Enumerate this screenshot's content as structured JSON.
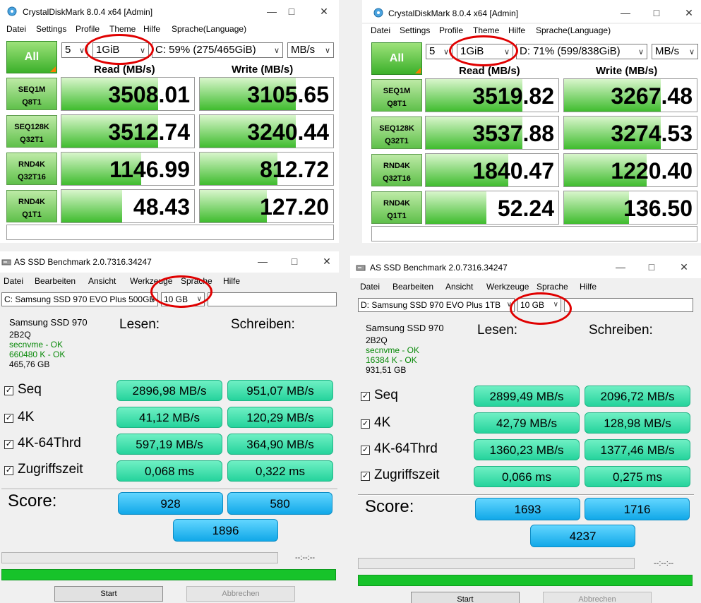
{
  "cdm_left": {
    "title": "CrystalDiskMark 8.0.4 x64 [Admin]",
    "menu": [
      "Datei",
      "Settings",
      "Profile",
      "Theme",
      "Hilfe",
      "Sprache(Language)"
    ],
    "all_label": "All",
    "count": "5",
    "size": "1GiB",
    "drive": "C: 59% (275/465GiB)",
    "unit": "MB/s",
    "read_header": "Read (MB/s)",
    "write_header": "Write (MB/s)",
    "rows": [
      {
        "l1": "SEQ1M",
        "l2": "Q8T1",
        "read": "3508.01",
        "write": "3105.65"
      },
      {
        "l1": "SEQ128K",
        "l2": "Q32T1",
        "read": "3512.74",
        "write": "3240.44"
      },
      {
        "l1": "RND4K",
        "l2": "Q32T16",
        "read": "1146.99",
        "write": "812.72"
      },
      {
        "l1": "RND4K",
        "l2": "Q1T1",
        "read": "48.43",
        "write": "127.20"
      }
    ]
  },
  "cdm_right": {
    "title": "CrystalDiskMark 8.0.4 x64 [Admin]",
    "menu": [
      "Datei",
      "Settings",
      "Profile",
      "Theme",
      "Hilfe",
      "Sprache(Language)"
    ],
    "all_label": "All",
    "count": "5",
    "size": "1GiB",
    "drive": "D: 71% (599/838GiB)",
    "unit": "MB/s",
    "read_header": "Read (MB/s)",
    "write_header": "Write (MB/s)",
    "rows": [
      {
        "l1": "SEQ1M",
        "l2": "Q8T1",
        "read": "3519.82",
        "write": "3267.48"
      },
      {
        "l1": "SEQ128K",
        "l2": "Q32T1",
        "read": "3537.88",
        "write": "3274.53"
      },
      {
        "l1": "RND4K",
        "l2": "Q32T16",
        "read": "1840.47",
        "write": "1220.40"
      },
      {
        "l1": "RND4K",
        "l2": "Q1T1",
        "read": "52.24",
        "write": "136.50"
      }
    ]
  },
  "asd_left": {
    "title": "AS SSD Benchmark 2.0.7316.34247",
    "menu": [
      "Datei",
      "Bearbeiten",
      "Ansicht",
      "Werkzeuge",
      "Sprache",
      "Hilfe"
    ],
    "drive_select": "C: Samsung SSD 970 EVO Plus 500GB",
    "size_select": "10 GB",
    "info": [
      "Samsung SSD 970",
      "2B2Q",
      "secnvme - OK",
      "660480 K - OK",
      "465,76 GB"
    ],
    "read_header": "Lesen:",
    "write_header": "Schreiben:",
    "rows": [
      {
        "label": "Seq",
        "read": "2896,98 MB/s",
        "write": "951,07 MB/s"
      },
      {
        "label": "4K",
        "read": "41,12 MB/s",
        "write": "120,29 MB/s"
      },
      {
        "label": "4K-64Thrd",
        "read": "597,19 MB/s",
        "write": "364,90 MB/s"
      },
      {
        "label": "Zugriffszeit",
        "read": "0,068 ms",
        "write": "0,322 ms"
      }
    ],
    "score_label": "Score:",
    "score_read": "928",
    "score_write": "580",
    "score_total": "1896",
    "timer": "--:--:--",
    "start_label": "Start",
    "abort_label": "Abbrechen",
    "progress": 1.0
  },
  "asd_right": {
    "title": "AS SSD Benchmark 2.0.7316.34247",
    "menu": [
      "Datei",
      "Bearbeiten",
      "Ansicht",
      "Werkzeuge",
      "Sprache",
      "Hilfe"
    ],
    "drive_select": "D: Samsung SSD 970 EVO Plus 1TB",
    "size_select": "10 GB",
    "info": [
      "Samsung SSD 970",
      "2B2Q",
      "secnvme - OK",
      "16384 K - OK",
      "931,51 GB"
    ],
    "read_header": "Lesen:",
    "write_header": "Schreiben:",
    "rows": [
      {
        "label": "Seq",
        "read": "2899,49 MB/s",
        "write": "2096,72 MB/s"
      },
      {
        "label": "4K",
        "read": "42,79 MB/s",
        "write": "128,98 MB/s"
      },
      {
        "label": "4K-64Thrd",
        "read": "1360,23 MB/s",
        "write": "1377,46 MB/s"
      },
      {
        "label": "Zugriffszeit",
        "read": "0,066 ms",
        "write": "0,275 ms"
      }
    ],
    "score_label": "Score:",
    "score_read": "1693",
    "score_write": "1716",
    "score_total": "4237",
    "timer": "--:--:--",
    "start_label": "Start",
    "abort_label": "Abbrechen",
    "progress": 1.0
  },
  "colors": {
    "annotation_ring": "#e00000",
    "cdm_green": "#3fbc2e",
    "asd_teal": "#25d39c",
    "asd_blue": "#11a8e8",
    "progress_green": "#17c32a"
  }
}
